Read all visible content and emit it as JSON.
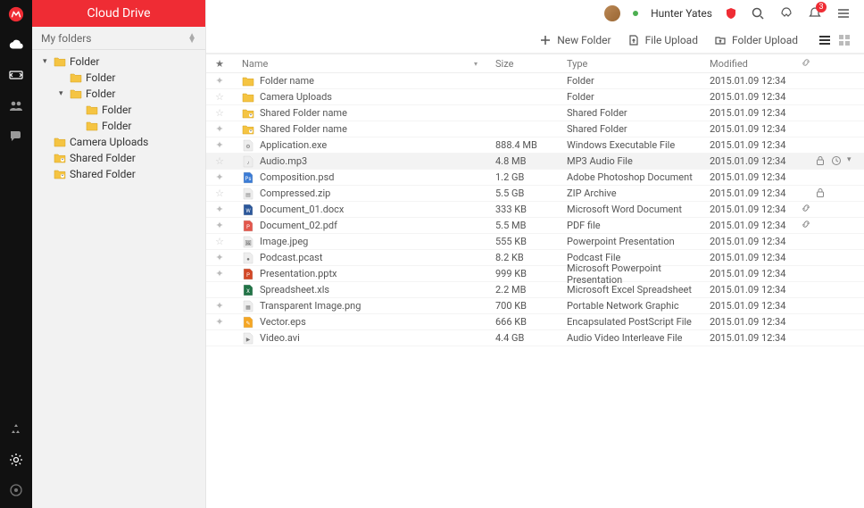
{
  "sidebar": {
    "header": "Cloud Drive",
    "myfolders": "My folders",
    "tree": [
      {
        "indent": 0,
        "caret": true,
        "label": "Folder"
      },
      {
        "indent": 1,
        "caret": false,
        "label": "Folder"
      },
      {
        "indent": 1,
        "caret": true,
        "label": "Folder"
      },
      {
        "indent": 2,
        "caret": false,
        "label": "Folder"
      },
      {
        "indent": 2,
        "caret": false,
        "label": "Folder"
      },
      {
        "indent": 0,
        "caret": false,
        "label": "Camera Uploads"
      },
      {
        "indent": 0,
        "caret": false,
        "label": "Shared Folder",
        "shared": true
      },
      {
        "indent": 0,
        "caret": false,
        "label": "Shared Folder",
        "shared": true
      }
    ]
  },
  "topbar": {
    "username": "Hunter Yates",
    "badge": "3"
  },
  "actionbar": {
    "newFolder": "New Folder",
    "fileUpload": "File Upload",
    "folderUpload": "Folder Upload"
  },
  "columns": {
    "name": "Name",
    "size": "Size",
    "type": "Type",
    "modified": "Modified"
  },
  "rows": [
    {
      "star": true,
      "icon": "folder",
      "name": "Folder name",
      "dot": "#ef2c34",
      "size": "",
      "type": "Folder",
      "modified": "2015.01.09 12:34"
    },
    {
      "star": false,
      "icon": "folder",
      "name": "Camera Uploads",
      "dot": "",
      "size": "",
      "type": "Folder",
      "modified": "2015.01.09 12:34"
    },
    {
      "star": false,
      "icon": "sharedfolder",
      "name": "Shared Folder name",
      "dot": "",
      "size": "",
      "type": "Shared Folder",
      "modified": "2015.01.09 12:34"
    },
    {
      "star": true,
      "icon": "sharedfolder",
      "name": "Shared Folder name",
      "dot": "#f5a623",
      "size": "",
      "type": "Shared Folder",
      "modified": "2015.01.09 12:34"
    },
    {
      "star": true,
      "icon": "exe",
      "name": "Application.exe",
      "dot": "",
      "size": "888.4 MB",
      "type": "Windows Executable File",
      "modified": "2015.01.09 12:34"
    },
    {
      "star": false,
      "icon": "audio",
      "name": "Audio.mp3",
      "dot": "",
      "size": "4.8 MB",
      "type": "MP3 Audio File",
      "modified": "2015.01.09 12:34",
      "selected": true,
      "lock": true,
      "clock": true,
      "more": true
    },
    {
      "star": true,
      "icon": "psd",
      "name": "Composition.psd",
      "dot": "#f5a623",
      "size": "1.2 GB",
      "type": "Adobe Photoshop Document",
      "modified": "2015.01.09 12:34"
    },
    {
      "star": false,
      "icon": "zip",
      "name": "Compressed.zip",
      "dot": "#4caf50",
      "size": "5.5 GB",
      "type": "ZIP Archive",
      "modified": "2015.01.09 12:34",
      "lock": true
    },
    {
      "star": true,
      "icon": "word",
      "name": "Document_01.docx",
      "dot": "#2196f3",
      "size": "333 KB",
      "type": "Microsoft Word Document",
      "modified": "2015.01.09 12:34",
      "link": true
    },
    {
      "star": true,
      "icon": "pdf",
      "name": "Document_02.pdf",
      "dot": "",
      "size": "5.5 MB",
      "type": "PDF file",
      "modified": "2015.01.09 12:34",
      "link": true
    },
    {
      "star": false,
      "icon": "image",
      "name": "Image.jpeg",
      "dot": "#9c27b0",
      "size": "555 KB",
      "type": "Powerpoint Presentation",
      "modified": "2015.01.09 12:34"
    },
    {
      "star": true,
      "icon": "podcast",
      "name": "Podcast.pcast",
      "dot": "#777",
      "size": "8.2 KB",
      "type": "Podcast File",
      "modified": "2015.01.09 12:34"
    },
    {
      "star": true,
      "icon": "ppt",
      "name": "Presentation.pptx",
      "dot": "",
      "size": "999 KB",
      "type": "Microsoft Powerpoint Presentation",
      "modified": "2015.01.09 12:34"
    },
    {
      "star": null,
      "icon": "xls",
      "name": "Spreadsheet.xls",
      "dot": "",
      "size": "2.2 MB",
      "type": "Microsoft Excel Spreadsheet",
      "modified": "2015.01.09 12:34"
    },
    {
      "star": true,
      "icon": "png",
      "name": "Transparent Image.png",
      "dot": "",
      "size": "700 KB",
      "type": "Portable Network Graphic",
      "modified": "2015.01.09 12:34"
    },
    {
      "star": true,
      "icon": "vector",
      "name": "Vector.eps",
      "dot": "",
      "size": "666 KB",
      "type": "Encapsulated PostScript File",
      "modified": "2015.01.09 12:34"
    },
    {
      "star": null,
      "icon": "video",
      "name": "Video.avi",
      "dot": "",
      "size": "4.4 GB",
      "type": "Audio Video Interleave File",
      "modified": "2015.01.09 12:34"
    }
  ]
}
